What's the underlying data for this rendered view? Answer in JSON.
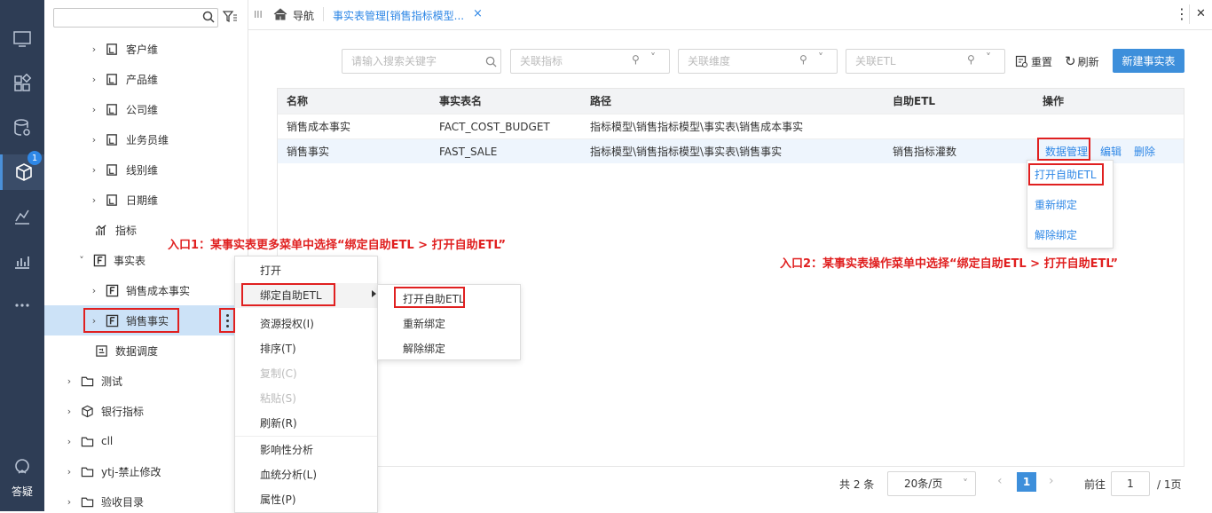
{
  "rail": {
    "badge": "1",
    "help_label": "答疑"
  },
  "tree": {
    "nodes": [
      {
        "label": "客户维"
      },
      {
        "label": "产品维"
      },
      {
        "label": "公司维"
      },
      {
        "label": "业务员维"
      },
      {
        "label": "线别维"
      },
      {
        "label": "日期维"
      },
      {
        "label": "指标"
      },
      {
        "label": "事实表"
      },
      {
        "label": "销售成本事实"
      },
      {
        "label": "销售事实"
      },
      {
        "label": "数据调度"
      },
      {
        "label": "测试"
      },
      {
        "label": "银行指标"
      },
      {
        "label": "cll"
      },
      {
        "label": "ytj-禁止修改"
      },
      {
        "label": "验收目录"
      }
    ]
  },
  "topbar": {
    "nav_label": "导航",
    "tab_label": "事实表管理[销售指标模型..."
  },
  "filters": {
    "search_placeholder": "请输入搜索关键字",
    "indicator_placeholder": "关联指标",
    "dimension_placeholder": "关联维度",
    "etl_placeholder": "关联ETL",
    "reset_label": "重置",
    "refresh_label": "刷新",
    "new_label": "新建事实表"
  },
  "table": {
    "headers": [
      "名称",
      "事实表名",
      "路径",
      "自助ETL",
      "操作"
    ],
    "rows": [
      {
        "name": "销售成本事实",
        "table": "FACT_COST_BUDGET",
        "path": "指标模型\\销售指标模型\\事实表\\销售成本事实",
        "etl": "",
        "ops": []
      },
      {
        "name": "销售事实",
        "table": "FAST_SALE",
        "path": "指标模型\\销售指标模型\\事实表\\销售事实",
        "etl": "销售指标灌数",
        "ops": [
          "数据管理",
          "编辑",
          "删除"
        ]
      }
    ]
  },
  "context_menu": {
    "items": [
      "打开",
      "绑定自助ETL",
      "资源授权(I)",
      "排序(T)",
      "复制(C)",
      "粘贴(S)",
      "刷新(R)",
      "影响性分析",
      "血统分析(L)",
      "属性(P)"
    ]
  },
  "submenu": {
    "items": [
      "打开自助ETL",
      "重新绑定",
      "解除绑定"
    ]
  },
  "ops_menu": {
    "items": [
      "打开自助ETL",
      "重新绑定",
      "解除绑定"
    ]
  },
  "annotations": {
    "entry1": "入口1：某事实表更多菜单中选择“绑定自助ETL > 打开自助ETL”",
    "entry2": "入口2：某事实表操作菜单中选择“绑定自助ETL > 打开自助ETL”"
  },
  "pager": {
    "total": "共 2 条",
    "page_size": "20条/页",
    "current": "1",
    "goto_label": "前往",
    "goto_value": "1",
    "pages_label": "/ 1页"
  }
}
